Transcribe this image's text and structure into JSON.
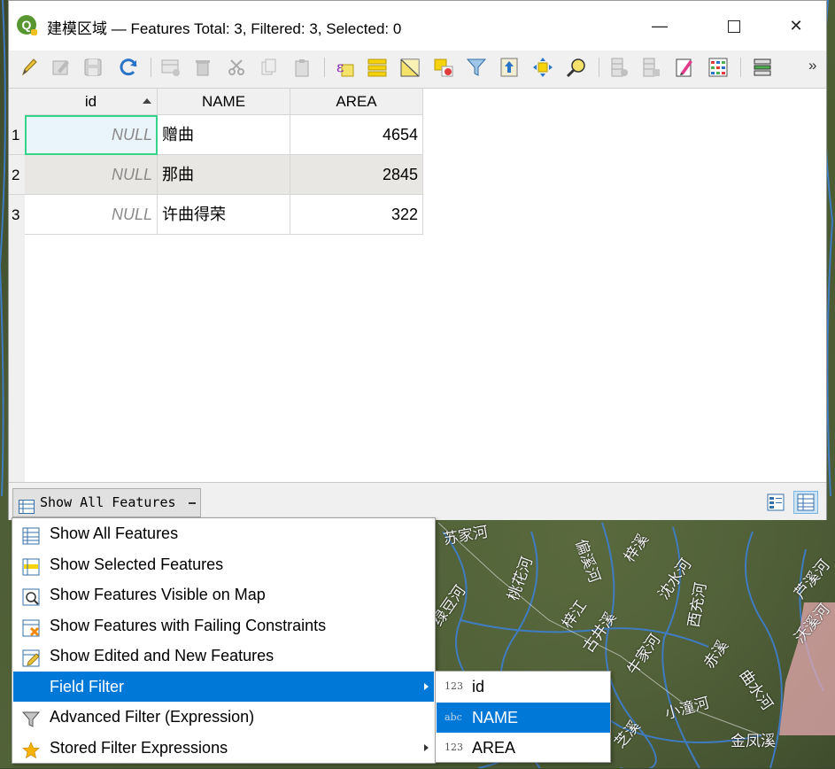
{
  "window": {
    "title": "建模区域 — Features Total: 3, Filtered: 3, Selected: 0",
    "minimize": "—",
    "close": "✕",
    "more": "»"
  },
  "toolbar_icons": [
    "toggle-edit-icon",
    "toggle-multi-edit-icon",
    "save-edits-icon",
    "reload-icon",
    "add-feature-icon",
    "delete-feature-icon",
    "cut-icon",
    "copy-icon",
    "paste-icon",
    "select-by-expression-icon",
    "select-all-icon",
    "invert-selection-icon",
    "deselect-all-icon",
    "filter-selection-icon",
    "move-selection-to-top-icon",
    "pan-to-selection-icon",
    "zoom-to-selection-icon",
    "new-field-icon",
    "delete-field-icon",
    "open-field-calculator-icon",
    "conditional-formatting-icon",
    "dock-table-icon"
  ],
  "table": {
    "columns": [
      "id",
      "NAME",
      "AREA"
    ],
    "rows": [
      {
        "row_num": "1",
        "id": "NULL",
        "name": "赠曲",
        "area": "4654"
      },
      {
        "row_num": "2",
        "id": "NULL",
        "name": "那曲",
        "area": "2845"
      },
      {
        "row_num": "3",
        "id": "NULL",
        "name": "许曲得荣",
        "area": "322"
      }
    ]
  },
  "filter_button": {
    "label": "Show All Features"
  },
  "filter_menu": {
    "items": [
      {
        "label": "Show All Features",
        "icon": "table-icon"
      },
      {
        "label": "Show Selected Features",
        "icon": "selected-rows-icon"
      },
      {
        "label": "Show Features Visible on Map",
        "icon": "map-visible-icon"
      },
      {
        "label": "Show Features with Failing Constraints",
        "icon": "failing-constraints-icon"
      },
      {
        "label": "Show Edited and New Features",
        "icon": "edited-features-icon"
      },
      {
        "label": "Field Filter",
        "icon": "none"
      },
      {
        "label": "Advanced Filter (Expression)",
        "icon": "funnel-icon"
      },
      {
        "label": "Stored Filter Expressions",
        "icon": "star-icon"
      }
    ]
  },
  "field_submenu": {
    "items": [
      {
        "type_tag": "123",
        "label": "id"
      },
      {
        "type_tag": "abc",
        "label": "NAME"
      },
      {
        "type_tag": "123",
        "label": "AREA"
      }
    ]
  },
  "map_labels": [
    "苏家河",
    "桃花河",
    "偏溪河",
    "梓溪",
    "沈水河",
    "芦溪河",
    "绿豆河",
    "梓江",
    "古井溪",
    "西充河",
    "沃溪河",
    "牛家河",
    "赤溪",
    "曲水河",
    "小潼河",
    "芝溪",
    "金凤溪"
  ],
  "colors": {
    "selection": "#0078d7",
    "focus_outline": "#35d48b",
    "qgis_green": "#589632"
  }
}
